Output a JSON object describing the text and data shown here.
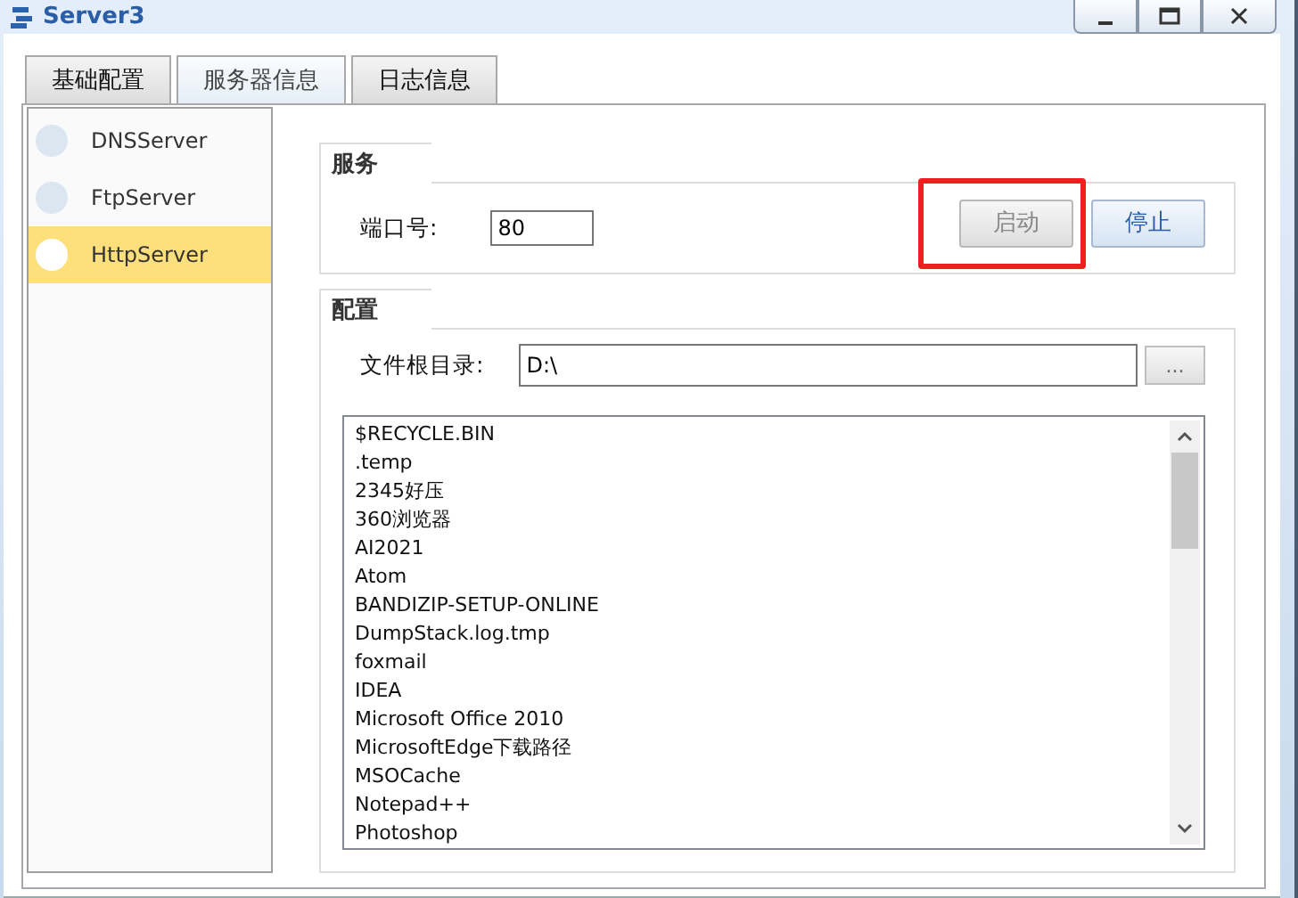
{
  "window": {
    "title": "Server3"
  },
  "tabs": [
    {
      "label": "基础配置",
      "selected": false
    },
    {
      "label": "服务器信息",
      "selected": true
    },
    {
      "label": "日志信息",
      "selected": false
    }
  ],
  "sidebar": {
    "items": [
      {
        "label": "DNSServer",
        "selected": false
      },
      {
        "label": "FtpServer",
        "selected": false
      },
      {
        "label": "HttpServer",
        "selected": true
      }
    ]
  },
  "service": {
    "title": "服务",
    "port_label": "端口号:",
    "port_value": "80",
    "buttons": [
      {
        "label": "启动",
        "disabled": true,
        "highlighted": true
      },
      {
        "label": "停止",
        "disabled": false,
        "highlighted": false
      }
    ]
  },
  "config": {
    "title": "配置",
    "root_label": "文件根目录:",
    "root_value": "D:\\",
    "browse_label": "...",
    "files": [
      "$RECYCLE.BIN",
      ".temp",
      "2345好压",
      "360浏览器",
      "AI2021",
      "Atom",
      "BANDIZIP-SETUP-ONLINE",
      "DumpStack.log.tmp",
      "foxmail",
      "IDEA",
      "Microsoft Office 2010",
      "MicrosoftEdge下载路径",
      "MSOCache",
      "Notepad++",
      "Photoshop"
    ]
  }
}
